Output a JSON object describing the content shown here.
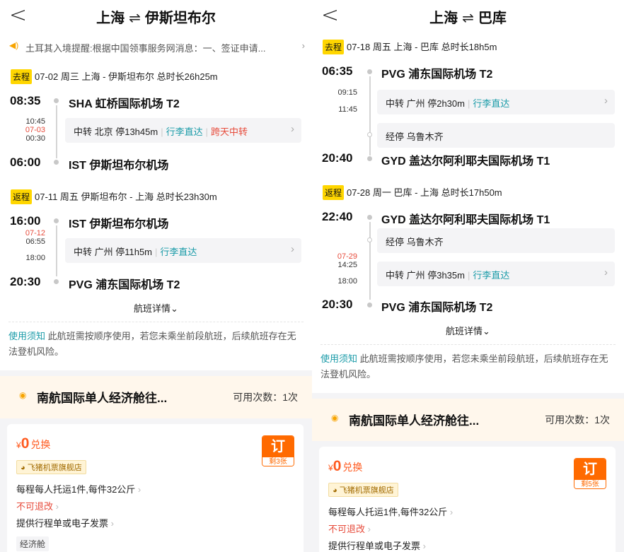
{
  "left": {
    "header": {
      "back_glyph": "<",
      "origin": "上海",
      "swap_glyph": "⇌",
      "destination": "伊斯坦布尔"
    },
    "notice": {
      "text": "土耳其入境提醒:根据中国领事服务网消息：一、签证申请..."
    },
    "outbound": {
      "tag": "去程",
      "summary": "07-02 周三 上海 - 伊斯坦布尔 总时长26h25m",
      "dep_time": "08:35",
      "dep_airport": "SHA 虹桥国际机场 T2",
      "stop_arr": "10:45",
      "stop_date": "07-03",
      "stop_dep": "00:30",
      "transfer": "中转 北京 停13h45m",
      "baggage": "行李直达",
      "overnight": "跨天中转",
      "arr_time": "06:00",
      "arr_airport": "IST 伊斯坦布尔机场"
    },
    "return": {
      "tag": "返程",
      "summary": "07-11 周五 伊斯坦布尔 - 上海 总时长23h30m",
      "dep_time": "16:00",
      "dep_airport": "IST 伊斯坦布尔机场",
      "stop_date": "07-12",
      "stop_arr": "06:55",
      "stop_dep": "18:00",
      "transfer": "中转 广州 停11h5m",
      "baggage": "行李直达",
      "arr_time": "20:30",
      "arr_airport": "PVG 浦东国际机场 T2"
    },
    "details_link": "航班详情⌄",
    "rules_link": "使用须知",
    "rules_text": " 此航班需按顺序使用，若您未乘坐前段航班，后续航班存在无法登机风险。",
    "product": {
      "name": "南航国际单人经济舱往...",
      "count": "可用次数：1次"
    },
    "offer": {
      "currency": "¥",
      "price": "0",
      "price_word": "兑换",
      "shop": "飞猪机票旗舰店",
      "line1": "每程每人托运1件,每件32公斤",
      "line2": "不可退改",
      "line3": "提供行程单或电子发票",
      "cabin": "经济舱",
      "book": "订",
      "remaining": "剩3张"
    }
  },
  "right": {
    "header": {
      "back_glyph": "<",
      "origin": "上海",
      "swap_glyph": "⇌",
      "destination": "巴库"
    },
    "outbound": {
      "tag": "去程",
      "summary": "07-18 周五 上海 - 巴库 总时长18h5m",
      "dep_time": "06:35",
      "dep_airport": "PVG 浦东国际机场 T2",
      "stop_arr": "09:15",
      "stop_dep": "11:45",
      "transfer": "中转 广州 停2h30m",
      "baggage": "行李直达",
      "via": "经停 乌鲁木齐",
      "arr_time": "20:40",
      "arr_airport": "GYD 盖达尔阿利耶夫国际机场 T1"
    },
    "return": {
      "tag": "返程",
      "summary": "07-28 周一 巴库 - 上海 总时长17h50m",
      "dep_time": "22:40",
      "dep_airport": "GYD 盖达尔阿利耶夫国际机场 T1",
      "via": "经停 乌鲁木齐",
      "stop_date": "07-29",
      "stop_arr": "14:25",
      "stop_dep": "18:00",
      "transfer": "中转 广州 停3h35m",
      "baggage": "行李直达",
      "arr_time": "20:30",
      "arr_airport": "PVG 浦东国际机场 T2"
    },
    "details_link": "航班详情⌄",
    "rules_link": "使用须知",
    "rules_text": " 此航班需按顺序使用，若您未乘坐前段航班，后续航班存在无法登机风险。",
    "product": {
      "name": "南航国际单人经济舱往...",
      "count": "可用次数：1次"
    },
    "offer": {
      "currency": "¥",
      "price": "0",
      "price_word": "兑换",
      "shop": "飞猪机票旗舰店",
      "line1": "每程每人托运1件,每件32公斤",
      "line2": "不可退改",
      "line3": "提供行程单或电子发票",
      "book": "订",
      "remaining": "剩5张"
    }
  },
  "colors": {
    "accent_teal": "#1a9ba8",
    "tag_yellow": "#ffd600",
    "orange": "#ff6a00",
    "red": "#e74c3c"
  }
}
